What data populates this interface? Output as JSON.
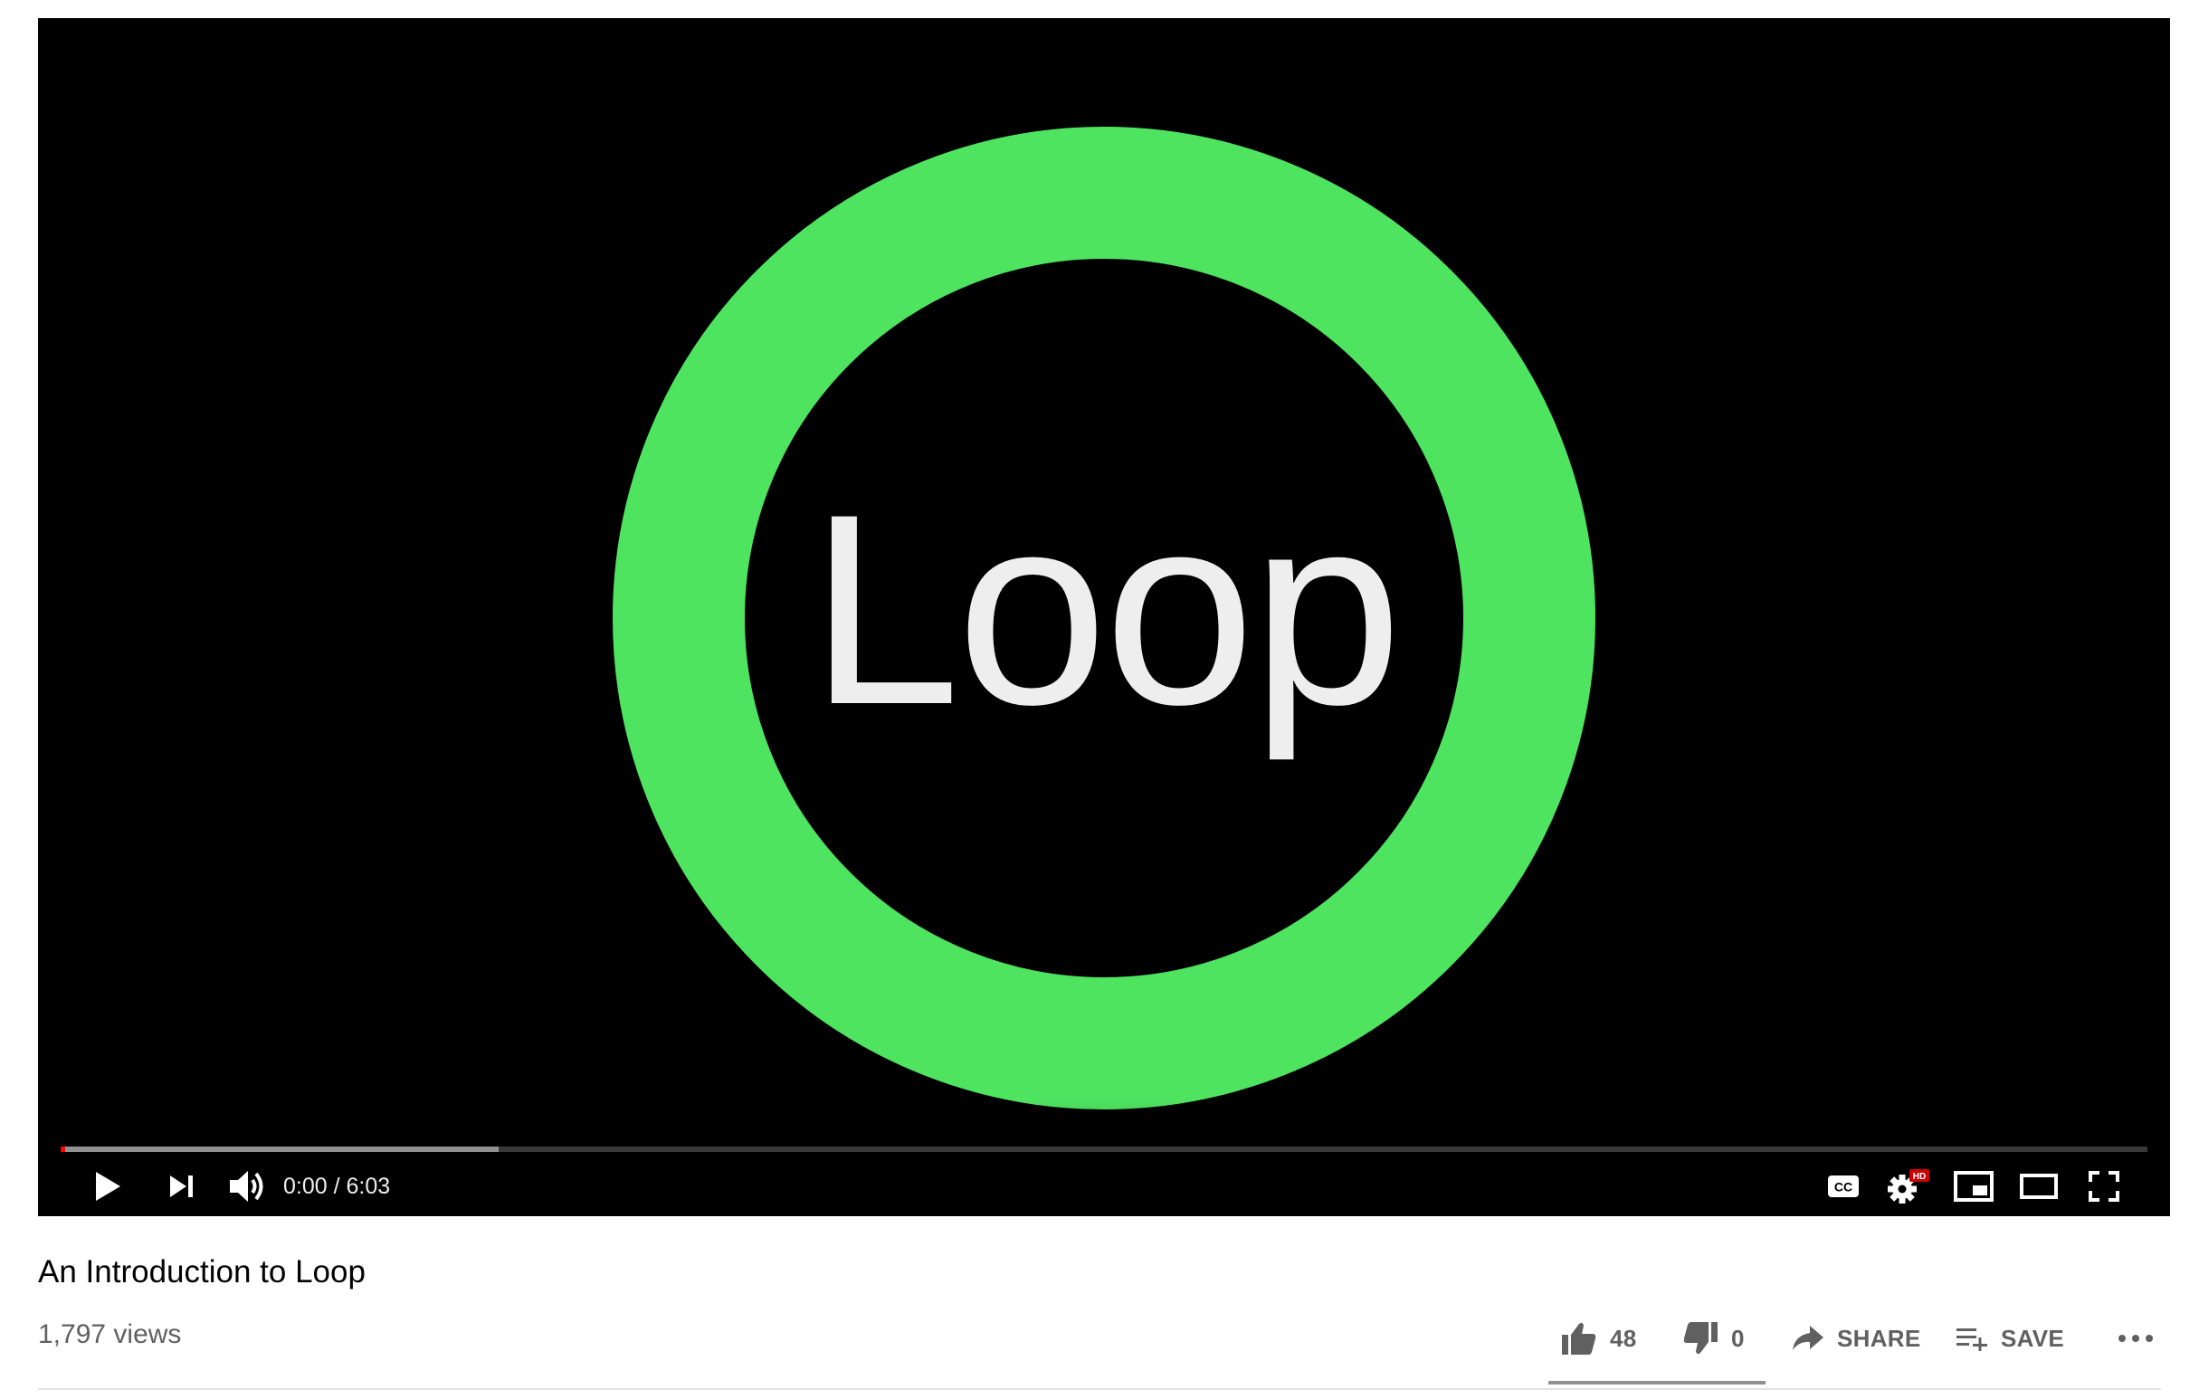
{
  "video": {
    "logo_text": "Loop",
    "ring_color": "#4fe460",
    "progress_loaded_fraction": 0.21,
    "progress_played_fraction": 0.0,
    "current_time": "0:00",
    "separator": " / ",
    "duration": "6:03",
    "controls": {
      "play_icon": "play-icon",
      "next_icon": "next-icon",
      "volume_icon": "volume-icon",
      "captions_label": "CC",
      "settings_badge": "HD",
      "miniplayer_icon": "miniplayer-icon",
      "theater_icon": "theater-mode-icon",
      "fullscreen_icon": "fullscreen-icon"
    }
  },
  "info": {
    "title": "An Introduction to Loop",
    "views": "1,797 views"
  },
  "actions": {
    "like_count": "48",
    "dislike_count": "0",
    "share_label": "SHARE",
    "save_label": "SAVE",
    "more_icon": "more-icon"
  }
}
